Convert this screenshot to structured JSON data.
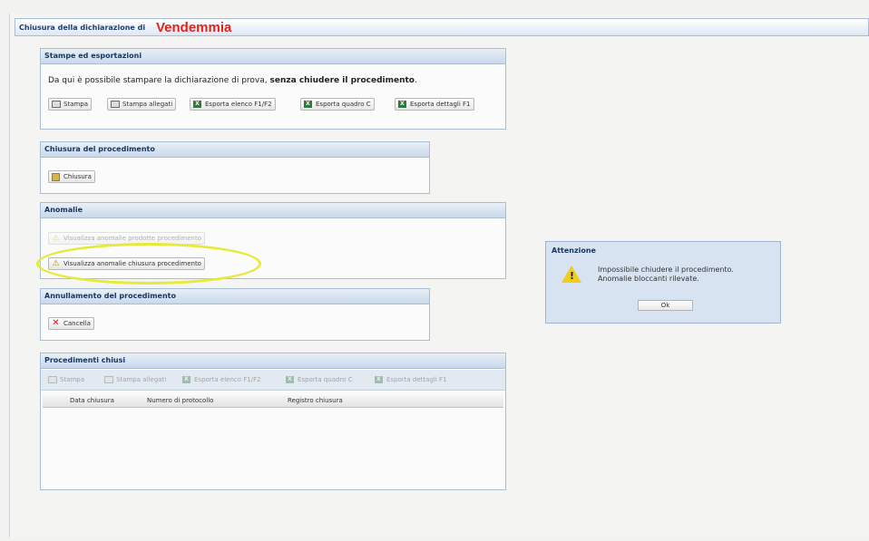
{
  "title": {
    "prefix": "Chiusura della dichiarazione di",
    "name": "Vendemmia"
  },
  "stampe": {
    "header": "Stampe ed esportazioni",
    "info_normal": "Da qui è possibile stampare la dichiarazione di prova, ",
    "info_bold": "senza chiudere il procedimento",
    "info_end": ".",
    "buttons": [
      "Stampa",
      "Stampa allegati",
      "Esporta elenco F1/F2",
      "Esporta quadro C",
      "Esporta dettagli F1"
    ]
  },
  "chiusura": {
    "header": "Chiusura del procedimento",
    "button": "Chiusura"
  },
  "anomalie": {
    "header": "Anomalie",
    "button1": "Visualizza anomalie prodotte procedimento",
    "button2": "Visualizza anomalie chiusura procedimento"
  },
  "annullamento": {
    "header": "Annullamento del procedimento",
    "button": "Cancella"
  },
  "chiusi": {
    "header": "Procedimenti chiusi",
    "buttons": [
      "Stampa",
      "Stampa allegati",
      "Esporta elenco F1/F2",
      "Esporta quadro C",
      "Esporta dettagli F1"
    ],
    "columns": [
      "Data chiusura",
      "Numero di protocollo",
      "Registro chiusura"
    ]
  },
  "dialog": {
    "title": "Attenzione",
    "line1": "Impossibile chiudere il procedimento.",
    "line2": "Anomalie bloccanti rilevate.",
    "ok": "Ok"
  },
  "colors": {
    "title_red": "#e0231c",
    "panel_header": "#c9d8ea",
    "highlight": "#e6ea39",
    "dialog_bg": "#d7e3f1"
  }
}
